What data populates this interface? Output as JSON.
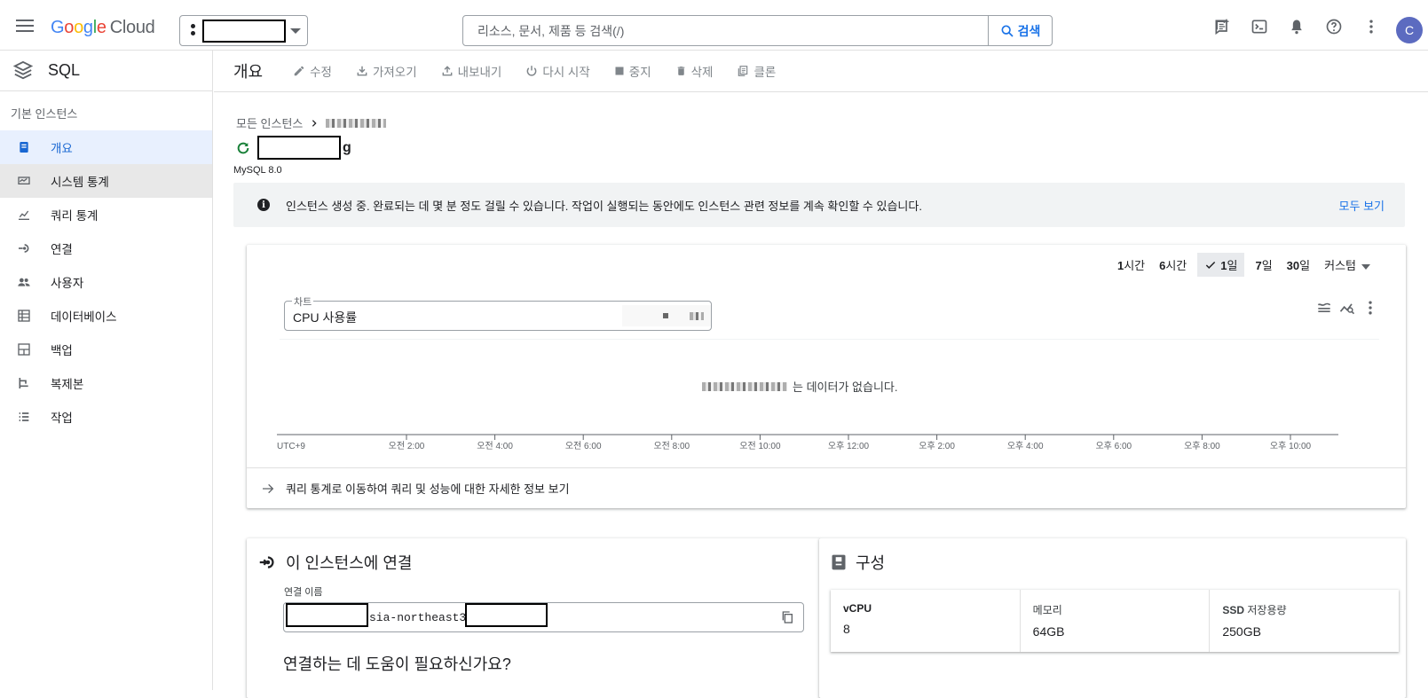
{
  "topbar": {
    "logo_google": "Google",
    "logo_cloud": "Cloud",
    "search_placeholder": "리소스, 문서, 제품 등 검색(/)",
    "search_button": "검색",
    "avatar_letter": "C",
    "icons": [
      "feedback-icon",
      "cloud-shell-icon",
      "notifications-icon",
      "help-icon",
      "more-vert-icon"
    ]
  },
  "sidebar": {
    "product": "SQL",
    "section": "기본 인스턴스",
    "items": [
      {
        "label": "개요",
        "icon": "overview-icon",
        "state": "active"
      },
      {
        "label": "시스템 통계",
        "icon": "system-insights-icon",
        "state": "hover"
      },
      {
        "label": "쿼리 통계",
        "icon": "query-insights-icon",
        "state": ""
      },
      {
        "label": "연결",
        "icon": "connections-icon",
        "state": ""
      },
      {
        "label": "사용자",
        "icon": "users-icon",
        "state": ""
      },
      {
        "label": "데이터베이스",
        "icon": "databases-icon",
        "state": ""
      },
      {
        "label": "백업",
        "icon": "backups-icon",
        "state": ""
      },
      {
        "label": "복제본",
        "icon": "replicas-icon",
        "state": ""
      },
      {
        "label": "작업",
        "icon": "operations-icon",
        "state": ""
      }
    ]
  },
  "actionbar": {
    "title": "개요",
    "actions": [
      "수정",
      "가져오기",
      "내보내기",
      "다시 시작",
      "중지",
      "삭제",
      "클론"
    ]
  },
  "instance": {
    "breadcrumb_root": "모든 인스턴스",
    "name_suffix": "g",
    "version": "MySQL 8.0"
  },
  "banner": {
    "message": "인스턴스 생성 중. 완료되는 데 몇 분 정도 걸릴 수 있습니다. 작업이 실행되는 동안에도 인스턴스 관련 정보를 계속 확인할 수 있습니다.",
    "link": "모두 보기"
  },
  "chart": {
    "time_ranges": [
      {
        "n": "1",
        "unit": "시간"
      },
      {
        "n": "6",
        "unit": "시간"
      },
      {
        "n": "1",
        "unit": "일"
      },
      {
        "n": "7",
        "unit": "일"
      },
      {
        "n": "30",
        "unit": "일"
      }
    ],
    "selected_range": "1일",
    "custom_label": "커스텀",
    "select_legend": "차트",
    "select_value": "CPU 사용률",
    "no_data": "는 데이터가 없습니다.",
    "x_ticks": [
      "UTC+9",
      "오전 2:00",
      "오전 4:00",
      "오전 6:00",
      "오전 8:00",
      "오전 10:00",
      "오후 12:00",
      "오후 2:00",
      "오후 4:00",
      "오후 6:00",
      "오후 8:00",
      "오후 10:00"
    ],
    "query_link": "쿼리 통계로 이동하여 쿼리 및 성능에 대한 자세한 정보 보기"
  },
  "connect": {
    "title": "이 인스턴스에 연결",
    "field_label": "연결 이름",
    "connection_name_visible": "sia-northeast3",
    "help_title": "연결하는 데 도움이 필요하신가요?"
  },
  "config": {
    "title": "구성",
    "items": [
      {
        "key": "vCPU",
        "value": "8"
      },
      {
        "key": "메모리",
        "value": "64GB"
      },
      {
        "key_bold": "SSD",
        "key_rest": " 저장용량",
        "value": "250GB"
      }
    ]
  }
}
